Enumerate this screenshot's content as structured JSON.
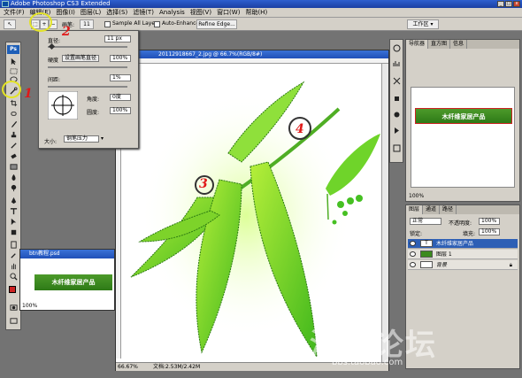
{
  "app": {
    "title": "Adobe Photoshop CS3 Extended"
  },
  "menubar": [
    "文件(F)",
    "编辑(E)",
    "图像(I)",
    "图层(L)",
    "选择(S)",
    "滤镜(T)",
    "Analysis",
    "视图(V)",
    "窗口(W)",
    "帮助(H)"
  ],
  "options": {
    "brush_label": "画笔:",
    "brush_size_value": "11",
    "sample_all_layers": "Sample All Layers",
    "auto_enhance": "Auto-Enhance",
    "refine_edge": "Refine Edge...",
    "workspace": "工作区 ▾"
  },
  "brush_popup": {
    "diameter_label": "直径:",
    "diameter_value": "11 px",
    "hardness_label": "硬度",
    "hardness_dropdown": "设置画笔直径",
    "hardness_value": "100%",
    "spacing_label": "间距:",
    "spacing_value": "1%",
    "angle_label": "角度:",
    "angle_value": "0度",
    "roundness_label": "圆度:",
    "roundness_value": "100%",
    "size_label": "大小:",
    "size_value": "钢笔压力"
  },
  "document": {
    "title": "20112918667_2.jpg @ 66.7%(RGB/8#)",
    "zoom": "66.67%",
    "doc_info": "文档:2.53M/2.42M"
  },
  "small_doc": {
    "title": "btn教程.psd",
    "banner_text": "木纤维家居产品",
    "zoom": "100%"
  },
  "navigator": {
    "tabs": [
      "导航器",
      "直方图",
      "信息"
    ],
    "banner_text": "木纤维家居产品",
    "zoom": "100%"
  },
  "layers": {
    "tabs": [
      "图层",
      "通道",
      "路径"
    ],
    "blend_mode": "正常",
    "opacity_label": "不透明度:",
    "opacity_value": "100%",
    "lock_label": "锁定:",
    "fill_label": "填充:",
    "fill_value": "100%",
    "rows": [
      {
        "name": "木纤维家居产品",
        "type": "text",
        "selected": true
      },
      {
        "name": "图层 1",
        "type": "layer",
        "selected": false
      },
      {
        "name": "背景",
        "type": "background",
        "selected": false
      }
    ]
  },
  "annotations": {
    "numbers": [
      "1",
      "2",
      "3",
      "4"
    ]
  },
  "watermark": {
    "text": "淘宝论坛",
    "url": "bbs.taobao.com"
  },
  "colors": {
    "accent_green": "#3b8a1f",
    "highlight_yellow": "#e3e325",
    "number_red": "#e01818"
  }
}
